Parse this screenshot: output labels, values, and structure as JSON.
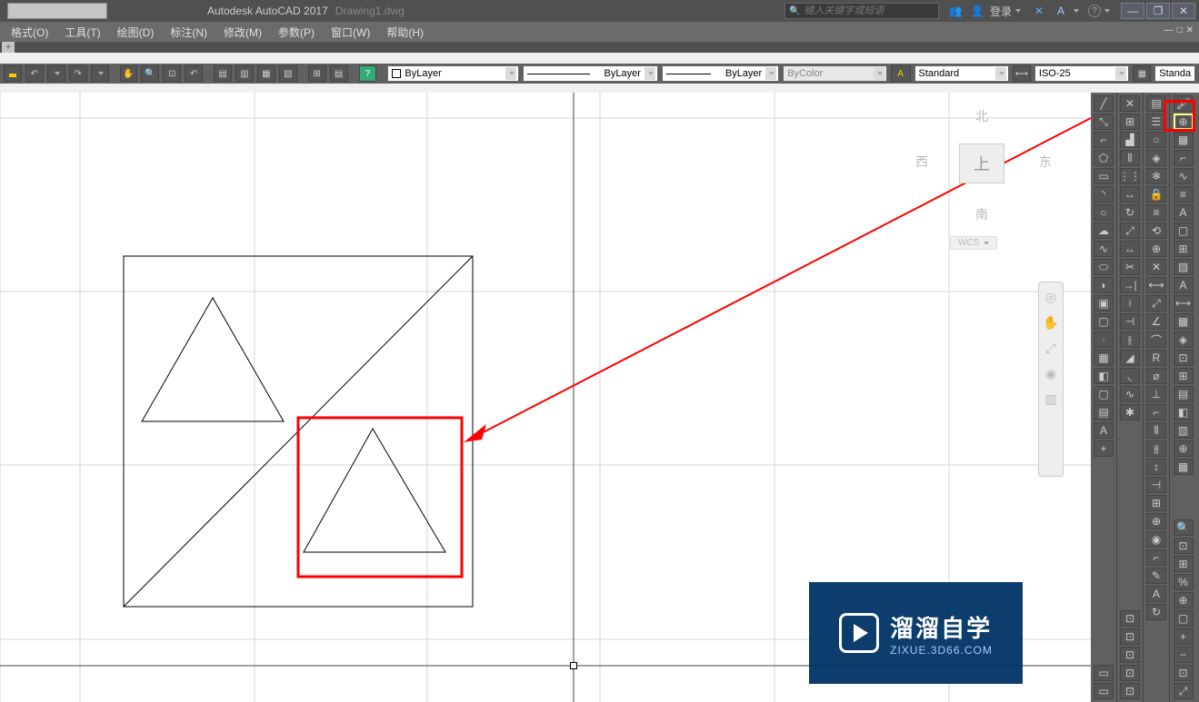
{
  "title": {
    "app": "Autodesk AutoCAD 2017",
    "file": "Drawing1.dwg"
  },
  "search": {
    "placeholder": "键入关键字或短语"
  },
  "login": "登录",
  "menus": {
    "format": "格式(O)",
    "tools": "工具(T)",
    "draw": "绘图(D)",
    "dimension": "标注(N)",
    "modify": "修改(M)",
    "parametric": "参数(P)",
    "window": "窗口(W)",
    "help": "帮助(H)"
  },
  "plus": "+",
  "props": {
    "layer_combo": "ByLayer",
    "linetype_combo": "ByLayer",
    "lineweight_combo": "ByLayer",
    "plotstyle_combo": "ByColor",
    "text_style": "Standard",
    "dim_style": "ISO-25",
    "table_style": "Standa"
  },
  "viewcube": {
    "north": "北",
    "south": "南",
    "east": "东",
    "west": "西",
    "top": "上",
    "wcs": "WCS"
  },
  "watermark": {
    "main": "溜溜自学",
    "sub": "ZIXUE.3D66.COM"
  },
  "icons": {
    "search": "🔍",
    "people": "👥",
    "person": "👤",
    "x": "✕",
    "a": "A",
    "help": "?",
    "min": "—",
    "max": "❐",
    "close": "✕",
    "undo": "↶",
    "redo": "↷",
    "pan": "✋",
    "zoom_ext": "⤢",
    "orbit": "◉",
    "wheel": "◎",
    "home": "⌂"
  },
  "tool_icons": {
    "line": "╱",
    "pline": "⌐",
    "circle": "○",
    "arc": "◝",
    "rect": "▭",
    "poly": "⬠",
    "ellipse": "⬭",
    "hatch": "▦",
    "text": "A",
    "dim": "⟷",
    "table": "▤",
    "region": "▢",
    "point": "·",
    "rev": "☁",
    "spline": "∿",
    "xline": "⤡",
    "ray": "↗",
    "mline": "≡",
    "donut": "◍",
    "wipe": "▨"
  },
  "modify_icons": {
    "move": "↔",
    "copy": "⊞",
    "rotate": "↻",
    "mirror": "▟",
    "scale": "⤢",
    "stretch": "↔",
    "trim": "✂",
    "extend": "→|",
    "fillet": "◟",
    "chamfer": "◢",
    "array": "⋮⋮",
    "offset": "⫴",
    "erase": "✕",
    "explode": "✱",
    "join": "⫲",
    "break": "⊣",
    "lengthen": "↦",
    "align": "⟂",
    "blend": "∿",
    "edit": "✎"
  },
  "layer_icons": {
    "props": "▤",
    "freeze": "❄",
    "off": "○",
    "lock": "🔒",
    "iso": "◈",
    "prev": "⟲",
    "match": "≡",
    "state": "☰",
    "merge": "⊕",
    "delete": "✕"
  },
  "edit_icons": {
    "hatch": "▦",
    "pedit": "⌐",
    "spline": "∿",
    "medit": "≡",
    "attr": "A",
    "block": "▢",
    "xref": "⊞",
    "image": "▨",
    "text": "A",
    "dim": "⟷"
  }
}
